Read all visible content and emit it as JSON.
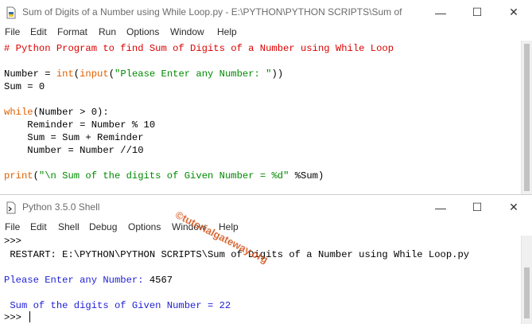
{
  "editor": {
    "title": "Sum of Digits of a Number using While Loop.py - E:\\PYTHON\\PYTHON SCRIPTS\\Sum of Digi...",
    "menu": [
      "File",
      "Edit",
      "Format",
      "Run",
      "Options",
      "Window",
      "Help"
    ],
    "code": {
      "comment": "# Python Program to find Sum of Digits of a Number using While Loop",
      "l3_pre": "Number = ",
      "l3_int": "int",
      "l3_mid": "(",
      "l3_input": "input",
      "l3_mid2": "(",
      "l3_str": "\"Please Enter any Number: \"",
      "l3_post": "))",
      "l4": "Sum = 0",
      "l6_kw": "while",
      "l6_post": "(Number > 0):",
      "l7": "    Reminder = Number % 10",
      "l8": "    Sum = Sum + Reminder",
      "l9": "    Number = Number //10",
      "l11_kw": "print",
      "l11_mid": "(",
      "l11_str": "\"\\n Sum of the digits of Given Number = %d\"",
      "l11_post": " %Sum)"
    }
  },
  "shell": {
    "title": "Python 3.5.0 Shell",
    "menu": [
      "File",
      "Edit",
      "Shell",
      "Debug",
      "Options",
      "Window",
      "Help"
    ],
    "lines": {
      "prompt1": ">>>",
      "restart": " RESTART: E:\\PYTHON\\PYTHON SCRIPTS\\Sum of Digits of a Number using While Loop.py",
      "input_prompt": "Please Enter any Number: ",
      "input_value": "4567",
      "result": " Sum of the digits of Given Number = 22",
      "prompt2": ">>> "
    }
  },
  "watermark": "©tutorialgateway.org",
  "window_controls": {
    "minimize": "—",
    "maximize": "☐",
    "close": "✕"
  }
}
